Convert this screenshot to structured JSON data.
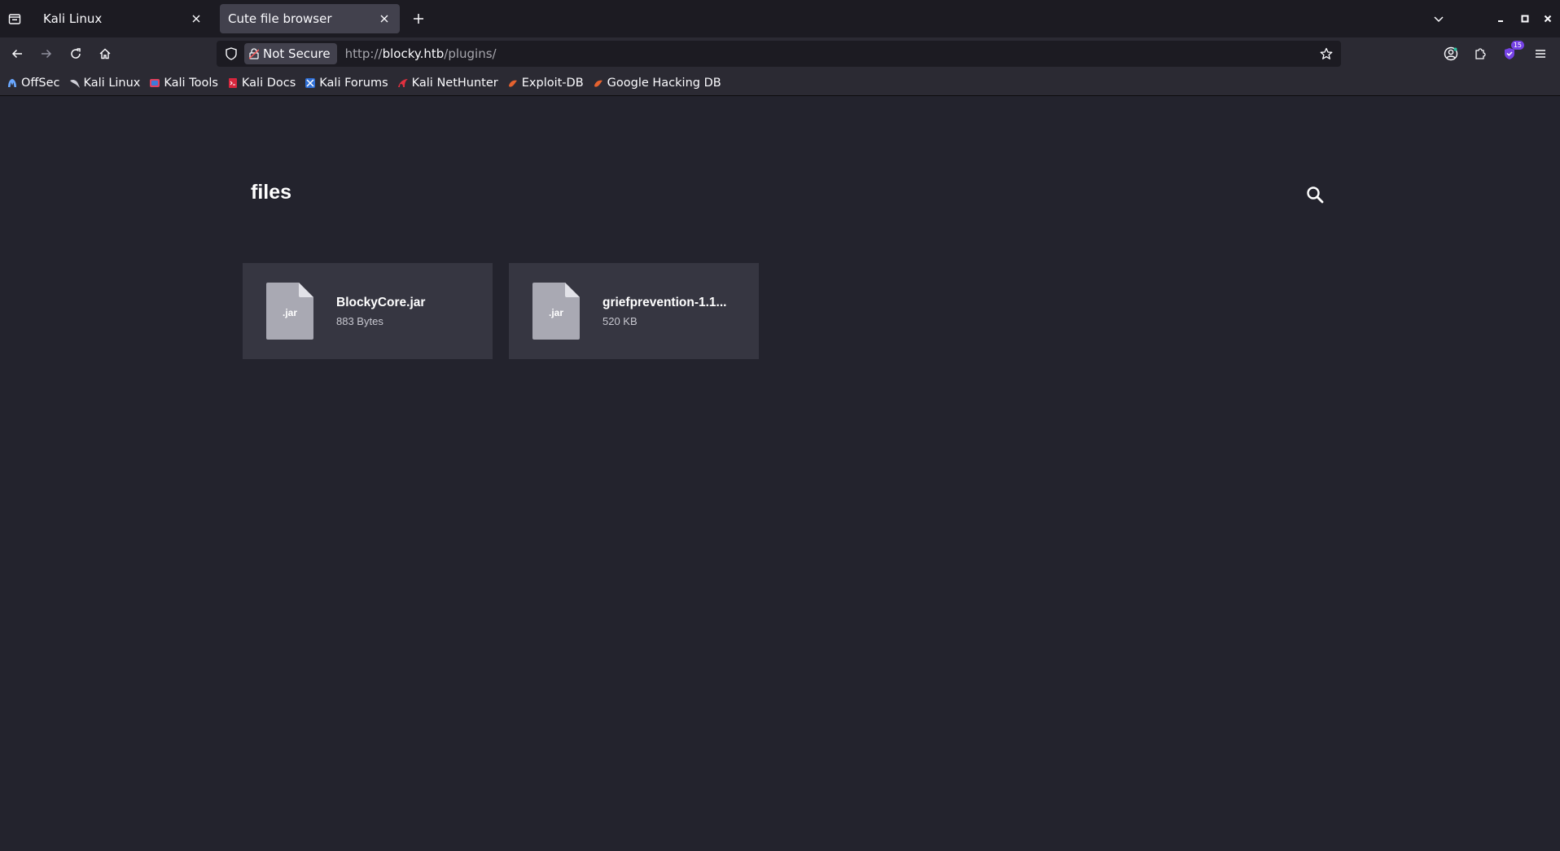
{
  "browser": {
    "tabs": [
      {
        "title": "Kali Linux",
        "active": false
      },
      {
        "title": "Cute file browser",
        "active": true
      }
    ],
    "urlbar": {
      "security_label": "Not Secure",
      "url_scheme": "http://",
      "url_host": "blocky.htb",
      "url_path": "/plugins/"
    },
    "extension_badge": "15",
    "bookmarks": [
      {
        "label": "OffSec",
        "icon": "offsec-icon"
      },
      {
        "label": "Kali Linux",
        "icon": "kali-dragon-icon"
      },
      {
        "label": "Kali Tools",
        "icon": "kali-tools-icon"
      },
      {
        "label": "Kali Docs",
        "icon": "kali-docs-icon"
      },
      {
        "label": "Kali Forums",
        "icon": "kali-forums-icon"
      },
      {
        "label": "Kali NetHunter",
        "icon": "kali-nethunter-icon"
      },
      {
        "label": "Exploit-DB",
        "icon": "exploit-db-icon"
      },
      {
        "label": "Google Hacking DB",
        "icon": "ghdb-icon"
      }
    ]
  },
  "page": {
    "title": "files",
    "files": [
      {
        "ext": ".jar",
        "name": "BlockyCore.jar",
        "size": "883 Bytes"
      },
      {
        "ext": ".jar",
        "name": "griefprevention-1.1...",
        "size": "520 KB"
      }
    ]
  },
  "colors": {
    "page_bg": "#23232d",
    "card_bg": "#363641",
    "file_icon": "#a9a9b3",
    "tabstrip_bg": "#1c1b22",
    "toolbar_bg": "#2b2a33",
    "extension_accent": "#7542e5"
  }
}
